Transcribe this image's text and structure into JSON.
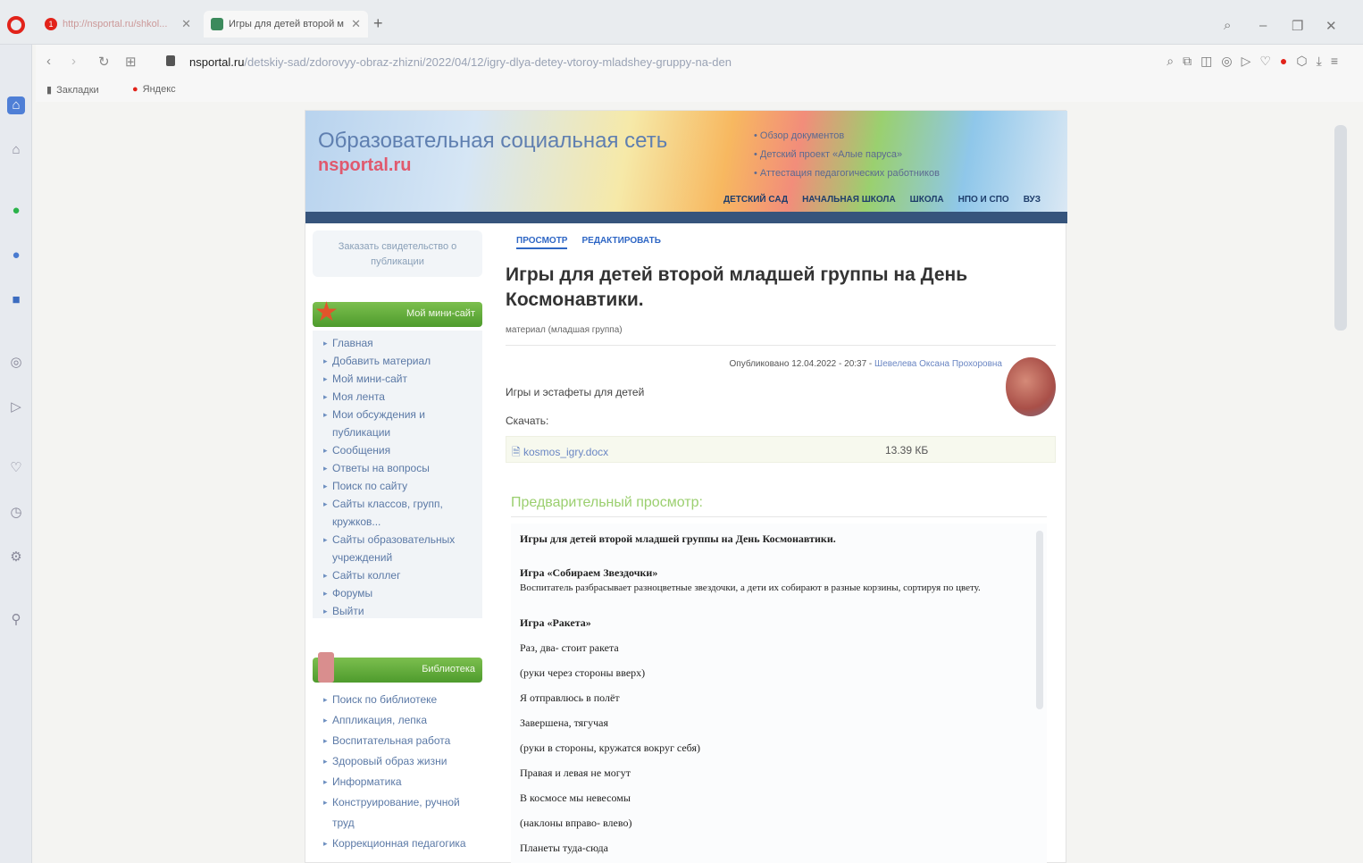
{
  "browser": {
    "tabs": [
      {
        "title": "http://nsportal.ru/shkol...",
        "badge": "1"
      },
      {
        "title": "Игры для детей второй м"
      }
    ],
    "url_domain": "nsportal.ru",
    "url_path": "/detskiy-sad/zdorovyy-obraz-zhizni/2022/04/12/igry-dlya-detey-vtoroy-mladshey-gruppy-na-den",
    "bookmarks": [
      "Закладки",
      "Яндекс"
    ]
  },
  "site": {
    "banner_title": "Образовательная социальная сеть",
    "banner_logo": "nsportal.ru",
    "banner_links": [
      "Обзор документов",
      "Детский проект «Алые паруса»",
      "Аттестация педагогических работников"
    ],
    "menu": [
      "ДЕТСКИЙ САД",
      "НАЧАЛЬНАЯ ШКОЛА",
      "ШКОЛА",
      "НПО И СПО",
      "ВУЗ"
    ]
  },
  "sidebar": {
    "certificate": "Заказать свидетельство о публикации",
    "my_site_header": "Мой мини-сайт",
    "items": [
      "Главная",
      "Добавить материал",
      "Мой мини-сайт",
      "Моя лента",
      "Мои обсуждения и публикации",
      "Сообщения",
      "Ответы на вопросы",
      "Поиск по сайту",
      "Сайты классов, групп, кружков...",
      "Сайты образовательных учреждений",
      "Сайты коллег",
      "Форумы",
      "Выйти"
    ],
    "library_header": "Библиотека",
    "library_items": [
      "Поиск по библиотеке",
      "Аппликация, лепка",
      "Воспитательная работа",
      "Здоровый образ жизни",
      "Информатика",
      "Конструирование, ручной труд",
      "Коррекционная педагогика"
    ]
  },
  "article": {
    "tabs": [
      "ПРОСМОТР",
      "РЕДАКТИРОВАТЬ"
    ],
    "title": "Игры для детей второй младшей группы на День Космонавтики.",
    "subtitle": "материал (младшая группа)",
    "published": "Опубликовано 12.04.2022 - 20:37 - ",
    "author": "Шевелева Оксана Прохоровна",
    "description": "Игры и эстафеты для детей",
    "download_label": "Скачать:",
    "file_name": "kosmos_igry.docx",
    "file_size": "13.39 КБ",
    "preview_header": "Предварительный просмотр:"
  },
  "preview": {
    "heading": "Игры для детей второй младшей группы на День Космонавтики.",
    "game1_title": "Игра «Собираем Звездочки»",
    "game1_text": "Воспитатель разбрасывает разноцветные звездочки, а дети их собирают в разные корзины, сортируя по цвету.",
    "game2_title": "Игра «Ракета»",
    "lines": [
      "Раз, два- стоит ракета",
      "(руки через стороны вверх)",
      "Я отправлюсь в полёт",
      "Завершена, тягучая",
      "(руки в стороны, кружатся вокруг себя)",
      "Правая и левая не могут",
      "В космосе мы невесомы",
      "(наклоны вправо- влево)",
      "Планеты туда-сюда"
    ]
  }
}
